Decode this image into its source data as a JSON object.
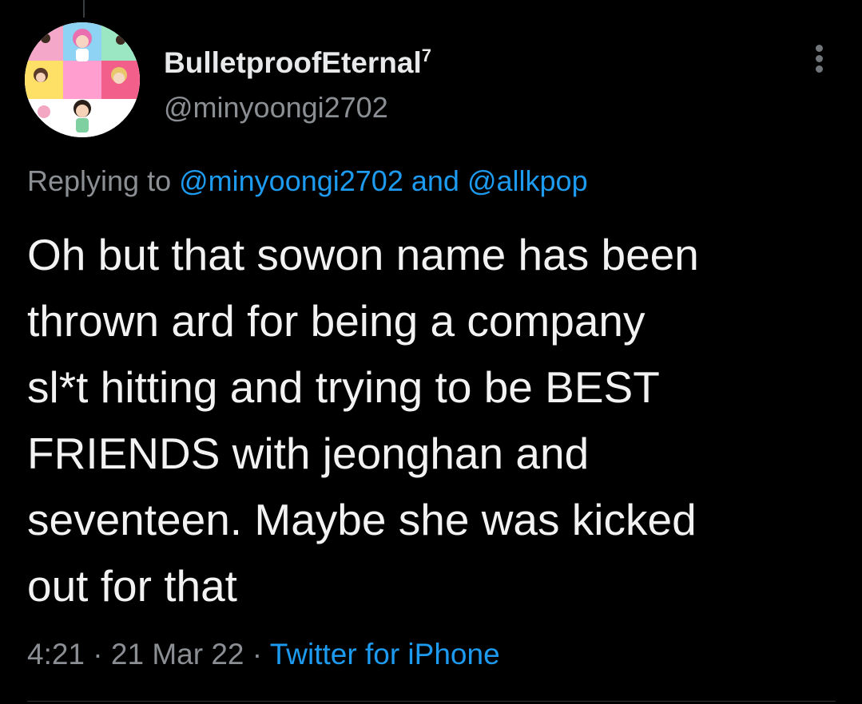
{
  "tweet": {
    "author": {
      "display_name": "BulletproofEternal",
      "badge": "7",
      "handle": "@minyoongi2702"
    },
    "replying": {
      "prefix": "Replying to",
      "mention_1": "@minyoongi2702",
      "conjunction": "and",
      "mention_2": "@allkpop"
    },
    "text_lines": [
      "Oh but that sowon name has been",
      "thrown ard for being a company",
      "sl*t hitting and trying to be BEST",
      "FRIENDS with jeonghan and",
      "seventeen. Maybe she was kicked",
      "out for that"
    ],
    "time": "4:21",
    "separator": "·",
    "date": "21 Mar 22",
    "source": "Twitter for iPhone",
    "more_icon": "more-vertical-icon"
  },
  "colors": {
    "background": "#000000",
    "text": "#e7e9ea",
    "muted": "#8b8f94",
    "accent": "#1d9bf0"
  }
}
